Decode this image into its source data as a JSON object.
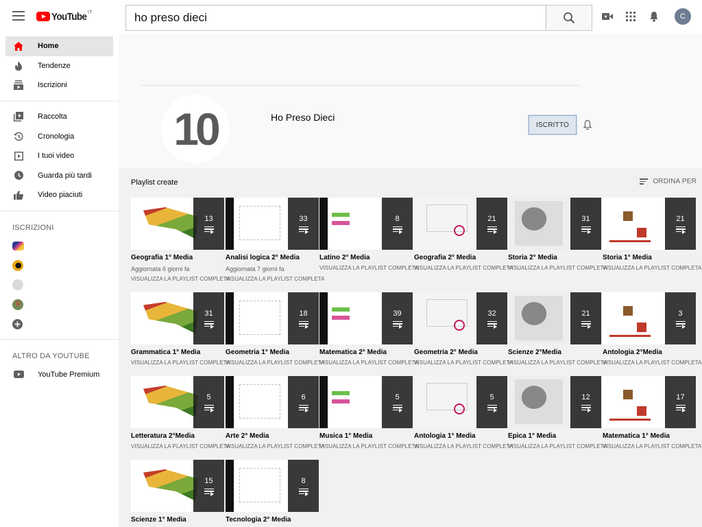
{
  "header": {
    "logo_text": "YouTube",
    "logo_country": "IT",
    "search_value": "ho preso dieci",
    "avatar_letter": "C"
  },
  "sidebar": {
    "main_items": [
      {
        "label": "Home",
        "icon": "home-icon",
        "active": true
      },
      {
        "label": "Tendenze",
        "icon": "trending-icon"
      },
      {
        "label": "Iscrizioni",
        "icon": "subscriptions-icon"
      }
    ],
    "library_items": [
      {
        "label": "Raccolta",
        "icon": "library-icon"
      },
      {
        "label": "Cronologia",
        "icon": "history-icon"
      },
      {
        "label": "I tuoi video",
        "icon": "your-videos-icon"
      },
      {
        "label": "Guarda più tardi",
        "icon": "watch-later-icon"
      },
      {
        "label": "Video piaciuti",
        "icon": "liked-icon"
      }
    ],
    "subscriptions_header": "ISCRIZIONI",
    "more_header": "ALTRO DA YOUTUBE",
    "premium_label": "YouTube Premium"
  },
  "channel": {
    "avatar_text": "10",
    "name": "Ho Preso Dieci",
    "subscribe_label": "ISCRITTO"
  },
  "content": {
    "section_title": "Playlist create",
    "sort_label": "ORDINA PER",
    "playlists": [
      {
        "title": "Geografia 1° Media",
        "count": "13",
        "meta": "Aggiornata 6 giorni fa",
        "link": "VISUALIZZA LA PLAYLIST COMPLETA"
      },
      {
        "title": "Analisi logica 2° Media",
        "count": "33",
        "meta": "Aggiornata 7 giorni fa",
        "link": "VISUALIZZA LA PLAYLIST COMPLETA"
      },
      {
        "title": "Latino 2° Media",
        "count": "8",
        "meta": "",
        "link": "VISUALIZZA LA PLAYLIST COMPLETA"
      },
      {
        "title": "Geografia 2° Media",
        "count": "21",
        "meta": "",
        "link": "VISUALIZZA LA PLAYLIST COMPLETA"
      },
      {
        "title": "Storia 2° Media",
        "count": "31",
        "meta": "",
        "link": "VISUALIZZA LA PLAYLIST COMPLETA"
      },
      {
        "title": "Storia 1° Media",
        "count": "21",
        "meta": "",
        "link": "VISUALIZZA LA PLAYLIST COMPLETA"
      },
      {
        "title": "Grammatica 1° Media",
        "count": "31",
        "meta": "",
        "link": "VISUALIZZA LA PLAYLIST COMPLETA"
      },
      {
        "title": "Geometria 1° Media",
        "count": "18",
        "meta": "",
        "link": "VISUALIZZA LA PLAYLIST COMPLETA"
      },
      {
        "title": "Matematica 2° Media",
        "count": "39",
        "meta": "",
        "link": "VISUALIZZA LA PLAYLIST COMPLETA"
      },
      {
        "title": "Geometria 2° Media",
        "count": "32",
        "meta": "",
        "link": "VISUALIZZA LA PLAYLIST COMPLETA"
      },
      {
        "title": "Scienze 2°Media",
        "count": "21",
        "meta": "",
        "link": "VISUALIZZA LA PLAYLIST COMPLETA"
      },
      {
        "title": "Antologia 2°Media",
        "count": "3",
        "meta": "",
        "link": "VISUALIZZA LA PLAYLIST COMPLETA"
      },
      {
        "title": "Letteratura 2°Media",
        "count": "5",
        "meta": "",
        "link": "VISUALIZZA LA PLAYLIST COMPLETA"
      },
      {
        "title": "Arte 2° Media",
        "count": "6",
        "meta": "",
        "link": "VISUALIZZA LA PLAYLIST COMPLETA"
      },
      {
        "title": "Musica 1° Media",
        "count": "5",
        "meta": "",
        "link": "VISUALIZZA LA PLAYLIST COMPLETA"
      },
      {
        "title": "Antologia 1° Media",
        "count": "5",
        "meta": "",
        "link": "VISUALIZZA LA PLAYLIST COMPLETA"
      },
      {
        "title": "Epica 1° Media",
        "count": "12",
        "meta": "",
        "link": "VISUALIZZA LA PLAYLIST COMPLETA"
      },
      {
        "title": "Matematica 1° Media",
        "count": "17",
        "meta": "",
        "link": "VISUALIZZA LA PLAYLIST COMPLETA"
      },
      {
        "title": "Scienze 1° Media",
        "count": "15",
        "meta": "",
        "link": ""
      },
      {
        "title": "Tecnologia 2° Media",
        "count": "8",
        "meta": "",
        "link": ""
      }
    ]
  },
  "colors": {
    "brand_red": "#ff0000",
    "sidebar_active": "#e5e5e5",
    "content_bg": "#f1f1f1"
  }
}
